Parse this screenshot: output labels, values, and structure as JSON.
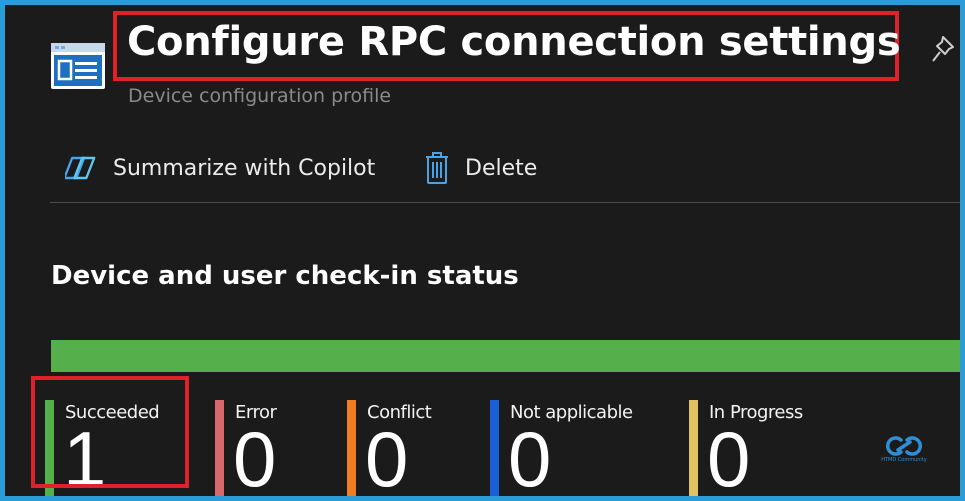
{
  "header": {
    "title": "Configure RPC connection settings",
    "subtitle": "Device configuration profile",
    "icon": "profile-icon",
    "pin_icon": "pin-icon"
  },
  "toolbar": {
    "copilot_label": "Summarize with Copilot",
    "copilot_icon": "copilot-icon",
    "delete_label": "Delete",
    "delete_icon": "trash-icon"
  },
  "checkin": {
    "section_title": "Device and user check-in status",
    "bar_fill_fraction": 1.0,
    "statuses": [
      {
        "label": "Succeeded",
        "value": "1",
        "color": "#55b04c"
      },
      {
        "label": "Error",
        "value": "0",
        "color": "#d9686c"
      },
      {
        "label": "Conflict",
        "value": "0",
        "color": "#f07c24"
      },
      {
        "label": "Not applicable",
        "value": "0",
        "color": "#1a5fd6"
      },
      {
        "label": "In Progress",
        "value": "0",
        "color": "#e0c262"
      }
    ]
  },
  "watermark": {
    "text": "HTMD Community"
  },
  "colors": {
    "highlight": "#e0212b",
    "accent": "#2b9cd8",
    "background": "#1b1b1b"
  }
}
